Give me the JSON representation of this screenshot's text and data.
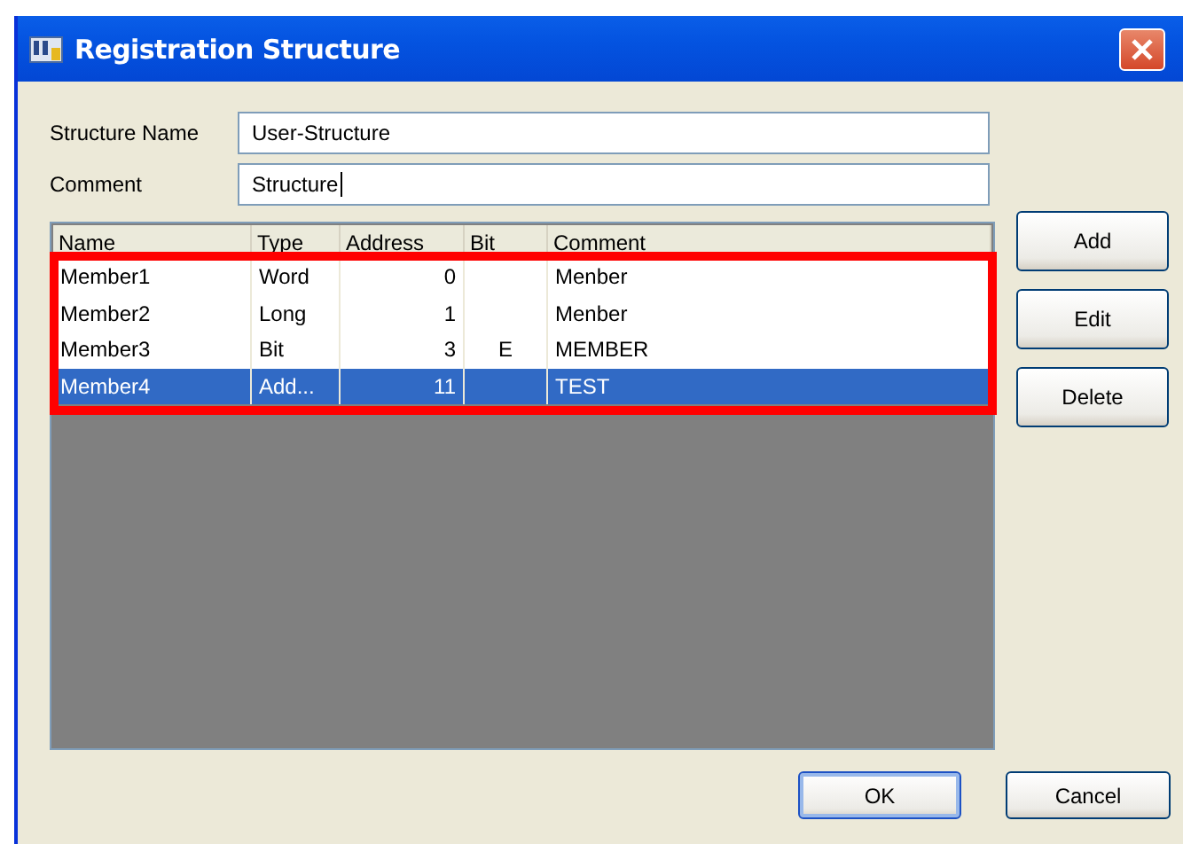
{
  "window": {
    "title": "Registration Structure"
  },
  "fields": [
    {
      "label": "Structure Name",
      "value": "User-Structure",
      "focused": false
    },
    {
      "label": "Comment",
      "value": "Structure",
      "focused": true
    }
  ],
  "table": {
    "columns": [
      "Name",
      "Type",
      "Address",
      "Bit",
      "Comment"
    ],
    "rows": [
      {
        "cells": [
          "Member1",
          "Word",
          "0",
          "",
          "Menber"
        ],
        "selected": false
      },
      {
        "cells": [
          "Member2",
          "Long",
          "1",
          "",
          "Menber"
        ],
        "selected": false
      },
      {
        "cells": [
          "Member3",
          "Bit",
          "3",
          "E",
          "MEMBER"
        ],
        "selected": false
      },
      {
        "cells": [
          "Member4",
          "Add...",
          "11",
          "",
          "TEST"
        ],
        "selected": true
      }
    ]
  },
  "side_buttons": [
    "Add",
    "Edit",
    "Delete"
  ],
  "buttons": [
    {
      "label": "OK",
      "default": true
    },
    {
      "label": "Cancel",
      "default": false
    }
  ]
}
